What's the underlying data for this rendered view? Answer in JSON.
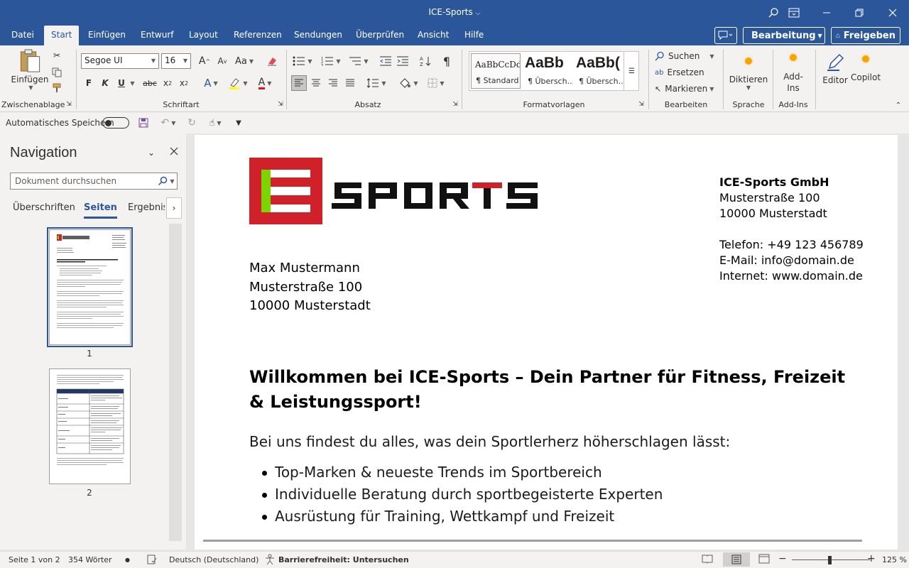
{
  "window": {
    "title": "ICE-Sports"
  },
  "menu": {
    "tabs": [
      "Datei",
      "Start",
      "Einfügen",
      "Entwurf",
      "Layout",
      "Referenzen",
      "Sendungen",
      "Überprüfen",
      "Ansicht",
      "Hilfe"
    ],
    "active_tab": "Start",
    "editing_mode": "Bearbeitung",
    "share": "Freigeben"
  },
  "ribbon": {
    "clipboard": {
      "label": "Zwischenablage",
      "paste": "Einfügen"
    },
    "font": {
      "label": "Schriftart",
      "font_name": "Segoe UI",
      "font_size": "16",
      "bold": "F",
      "italic": "K",
      "underline": "U"
    },
    "paragraph": {
      "label": "Absatz"
    },
    "styles": {
      "label": "Formatvorlagen",
      "items": [
        {
          "preview": "AaBbCcDd",
          "name": "¶ Standard"
        },
        {
          "preview": "AaBb",
          "name": "¶ Übersch..."
        },
        {
          "preview": "AaBb(",
          "name": "¶ Übersch..."
        }
      ]
    },
    "editing": {
      "label": "Bearbeiten",
      "find": "Suchen",
      "replace": "Ersetzen",
      "select": "Markieren"
    },
    "voice": {
      "label": "Sprache",
      "dictate": "Diktieren"
    },
    "addins": {
      "label": "Add-Ins",
      "button": "Add-Ins"
    },
    "editor": "Editor",
    "copilot": "Copilot"
  },
  "qat": {
    "autosave": "Automatisches Speichern"
  },
  "navigation": {
    "title": "Navigation",
    "search_placeholder": "Dokument durchsuchen",
    "tabs": [
      "Überschriften",
      "Seiten",
      "Ergebnisse"
    ],
    "active_tab": "Seiten",
    "pages": [
      "1",
      "2"
    ]
  },
  "document": {
    "logo_text": "SPORTS",
    "sender": {
      "company": "ICE-Sports GmbH",
      "street": "Musterstraße 100",
      "city": "10000 Musterstadt",
      "phone": "Telefon: +49 123 456789",
      "email": "E-Mail: info@domain.de",
      "web": "Internet: www.domain.de"
    },
    "recipient": {
      "name": "Max Mustermann",
      "street": "Musterstraße 100",
      "city": "10000 Musterstadt"
    },
    "heading": "Willkommen bei ICE-Sports – Dein Partner für Fitness, Freizeit & Leistungssport!",
    "intro": "Bei uns findest du alles, was dein Sportlerherz höherschlagen lässt:",
    "bullets": [
      "Top-Marken & neueste Trends im Sportbereich",
      "Individuelle Beratung durch sportbegeisterte Experten",
      "Ausrüstung für Training, Wettkampf und Freizeit"
    ]
  },
  "status": {
    "page": "Seite 1 von 2",
    "words": "354 Wörter",
    "language": "Deutsch (Deutschland)",
    "accessibility": "Barrierefreiheit: Untersuchen",
    "zoom": "125 %"
  },
  "colors": {
    "word_blue": "#2b579a",
    "logo_red": "#d0202a",
    "logo_green": "#7cd400"
  }
}
